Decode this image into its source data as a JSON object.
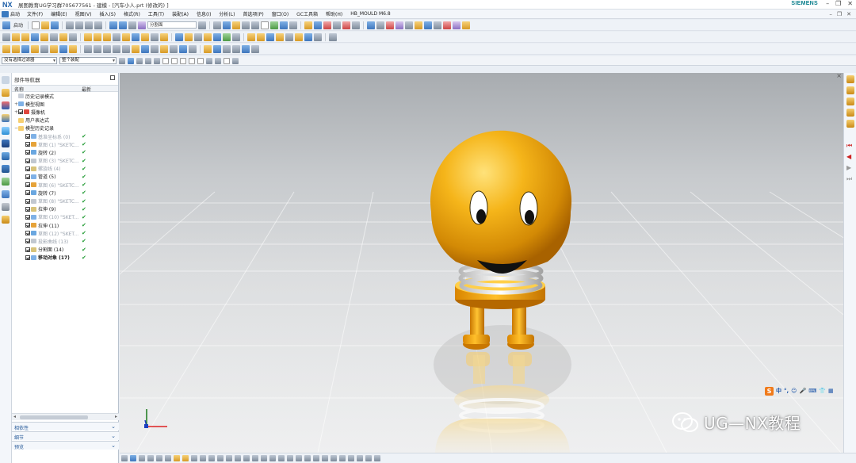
{
  "window": {
    "logo": "NX",
    "title": "展图教育UG学习群705677561 - 建模 - [汽车小人.prt  (修改的) ]",
    "brand": "SIEMENS"
  },
  "menubar": {
    "start_label": "启动",
    "items": [
      "文件(F)",
      "编辑(E)",
      "视图(V)",
      "插入(S)",
      "格式(R)",
      "工具(T)",
      "装配(A)",
      "信息(I)",
      "分析(L)",
      "首选项(P)",
      "窗口(O)",
      "GC工具箱",
      "帮助(H)",
      "HB_MOULD M6.8"
    ]
  },
  "toolbar": {
    "start_label": "启动",
    "split_face_field": "分割面"
  },
  "selection_bar": {
    "filter_value": "没有选择过滤器",
    "scope_value": "整个装配"
  },
  "navigator": {
    "title": "部件导航器",
    "col_name": "名称",
    "col_latest": "最新",
    "rows": [
      {
        "label": "历史记录模式",
        "level": 1,
        "dim": false,
        "bold": false,
        "check": false,
        "tick": false
      },
      {
        "label": "模型视图",
        "level": 1,
        "dim": false,
        "bold": false,
        "check": false,
        "tick": false
      },
      {
        "label": "摄像机",
        "level": 1,
        "dim": false,
        "bold": false,
        "check": true,
        "tick": false
      },
      {
        "label": "用户表达式",
        "level": 1,
        "dim": false,
        "bold": false,
        "check": false,
        "tick": false
      },
      {
        "label": "模型历史记录",
        "level": 1,
        "dim": false,
        "bold": false,
        "check": false,
        "tick": false
      },
      {
        "label": "基准坐标系 (0)",
        "level": 2,
        "dim": true,
        "bold": false,
        "check": true,
        "tick": true
      },
      {
        "label": "草图 (1) \"SKETC...",
        "level": 2,
        "dim": true,
        "bold": false,
        "check": true,
        "tick": true
      },
      {
        "label": "旋转 (2)",
        "level": 2,
        "dim": false,
        "bold": false,
        "check": true,
        "tick": true
      },
      {
        "label": "草图 (3) \"SKETC...",
        "level": 2,
        "dim": true,
        "bold": false,
        "check": true,
        "tick": true
      },
      {
        "label": "螺旋线 (4)",
        "level": 2,
        "dim": true,
        "bold": false,
        "check": true,
        "tick": true
      },
      {
        "label": "管道 (5)",
        "level": 2,
        "dim": false,
        "bold": false,
        "check": true,
        "tick": true
      },
      {
        "label": "草图 (6) \"SKETC...",
        "level": 2,
        "dim": true,
        "bold": false,
        "check": true,
        "tick": true
      },
      {
        "label": "旋转 (7)",
        "level": 2,
        "dim": false,
        "bold": false,
        "check": true,
        "tick": true
      },
      {
        "label": "草图 (8) \"SKETC...",
        "level": 2,
        "dim": true,
        "bold": false,
        "check": true,
        "tick": true
      },
      {
        "label": "拉伸 (9)",
        "level": 2,
        "dim": false,
        "bold": false,
        "check": true,
        "tick": true
      },
      {
        "label": "草图 (10) \"SKET...",
        "level": 2,
        "dim": true,
        "bold": false,
        "check": true,
        "tick": true
      },
      {
        "label": "拉伸 (11)",
        "level": 2,
        "dim": false,
        "bold": false,
        "check": true,
        "tick": true
      },
      {
        "label": "草图 (12) \"SKET...",
        "level": 2,
        "dim": true,
        "bold": false,
        "check": true,
        "tick": true
      },
      {
        "label": "投影曲线 (13)",
        "level": 2,
        "dim": true,
        "bold": false,
        "check": true,
        "tick": true
      },
      {
        "label": "分割面 (14)",
        "level": 2,
        "dim": false,
        "bold": false,
        "check": true,
        "tick": true
      },
      {
        "label": "移动对象 (17)",
        "level": 2,
        "dim": false,
        "bold": true,
        "check": true,
        "tick": true
      }
    ],
    "panels": [
      "相依性",
      "细节",
      "预览"
    ]
  },
  "ime": {
    "logo": "S",
    "items": [
      "中",
      "°,",
      "☺",
      "🎤",
      "⌨",
      "👕",
      "▦"
    ]
  },
  "watermark": {
    "text": "UG—NX教程"
  },
  "colors": {
    "ball": "#f4b21a",
    "ball_dark": "#b86a00",
    "accent": "#1c5ea8",
    "siemens": "#0a7e8c",
    "tick": "#1f9a31"
  }
}
